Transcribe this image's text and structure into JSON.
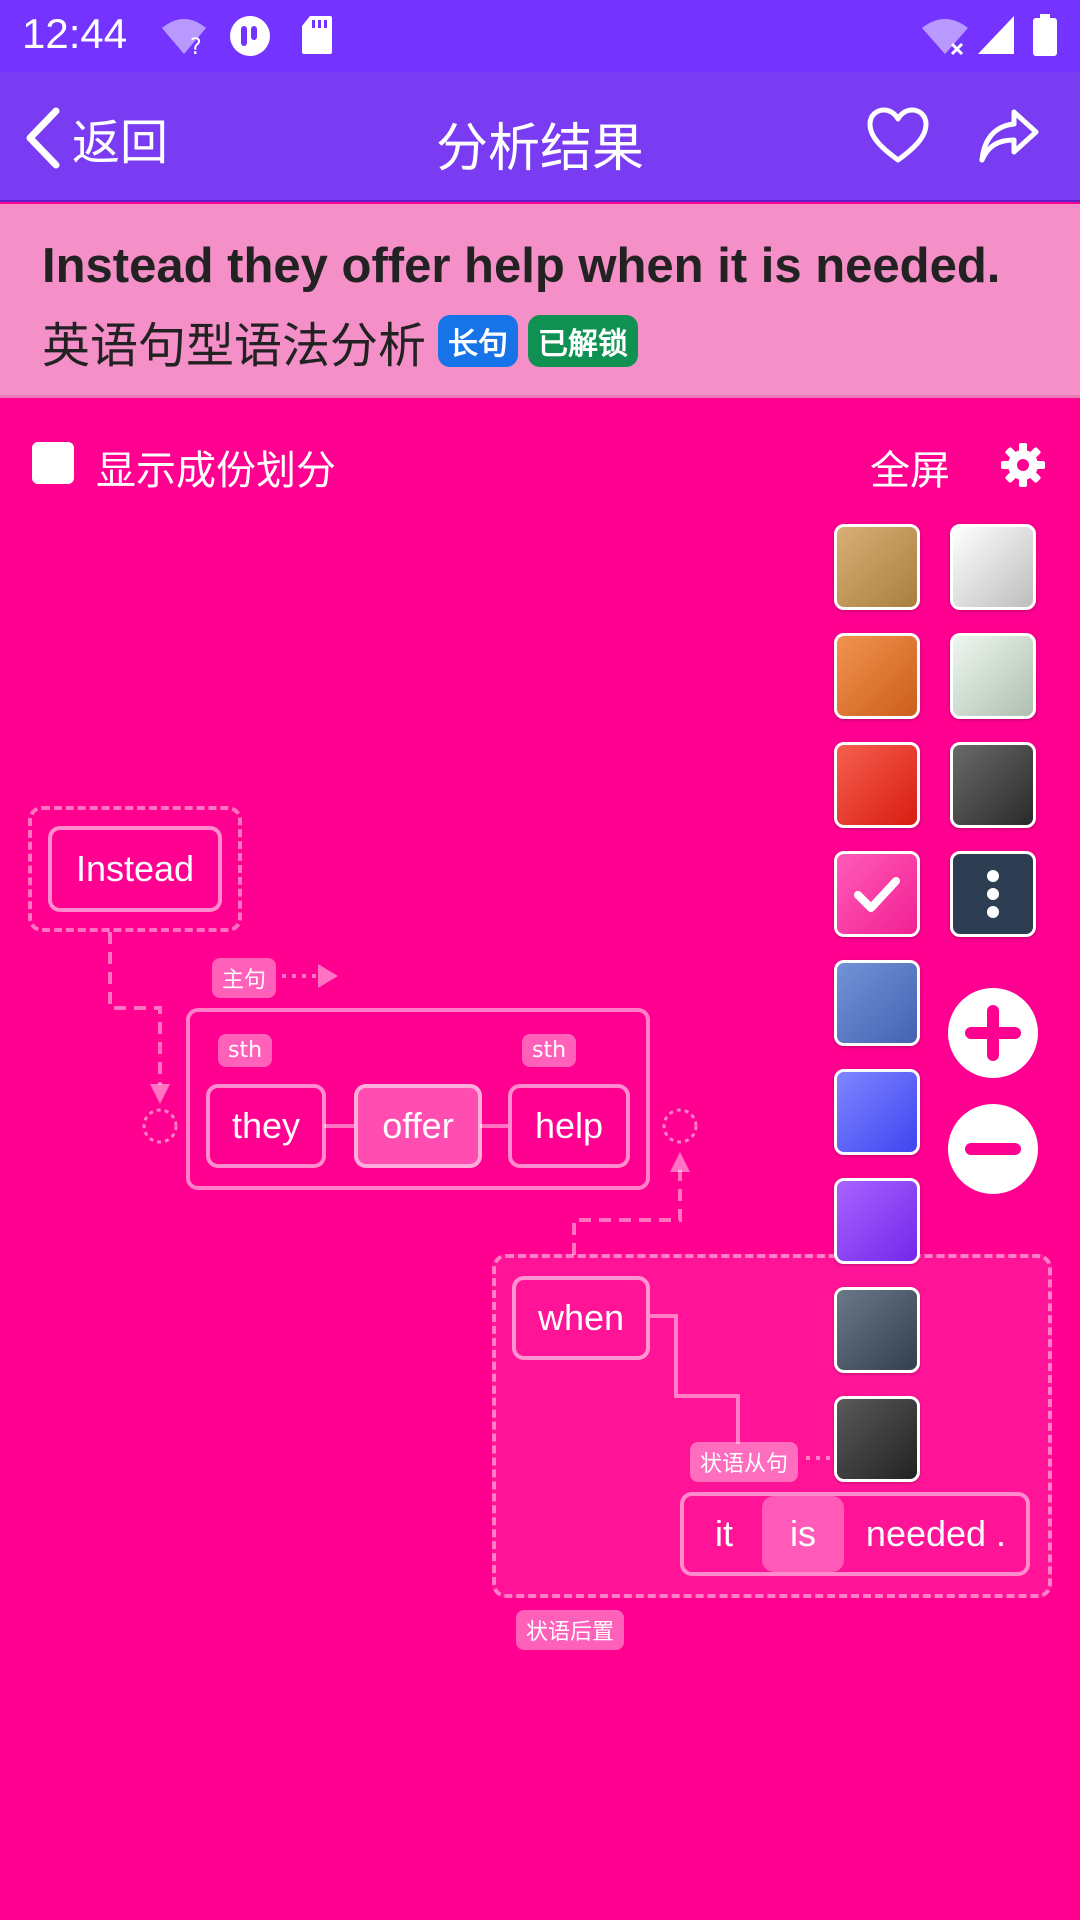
{
  "status_bar": {
    "time": "12:44",
    "icons": [
      "wifi-question-icon",
      "cat-icon",
      "sd-card-icon",
      "wifi-off-icon",
      "cell-signal-icon",
      "battery-icon"
    ]
  },
  "app_bar": {
    "back_label": "返回",
    "title": "分析结果",
    "icons": [
      "chevron-left-icon",
      "heart-icon",
      "share-icon"
    ]
  },
  "banner": {
    "sentence": "Instead they offer help when it is needed.",
    "subtitle": "英语句型语法分析",
    "badge_long": "长句",
    "badge_unlocked": "已解锁"
  },
  "toolbar": {
    "show_components_label": "显示成份划分",
    "show_components_checked": false,
    "fullscreen_label": "全屏"
  },
  "palette": {
    "left_column": [
      "#c49a5c",
      "#e07f3a",
      "#e8352b",
      "#ff3aa6",
      "#5e7ec9",
      "#5c62ff",
      "#8f47ff",
      "#4a5868",
      "#3a3a3a"
    ],
    "right_column": [
      "#e8e8e8",
      "#d6e6d8",
      "#4a4a4a",
      "#2d3e52"
    ],
    "selected": "#ff3aa6"
  },
  "diagram": {
    "words": {
      "instead": "Instead",
      "they": "they",
      "offer": "offer",
      "help": "help",
      "when": "when",
      "it": "it",
      "is": "is",
      "needed": "needed ."
    },
    "tags": {
      "main_clause": "主句",
      "sth_1": "sth",
      "sth_2": "sth",
      "adverbial_clause": "状语从句",
      "adverbial_postposed": "状语后置"
    }
  }
}
